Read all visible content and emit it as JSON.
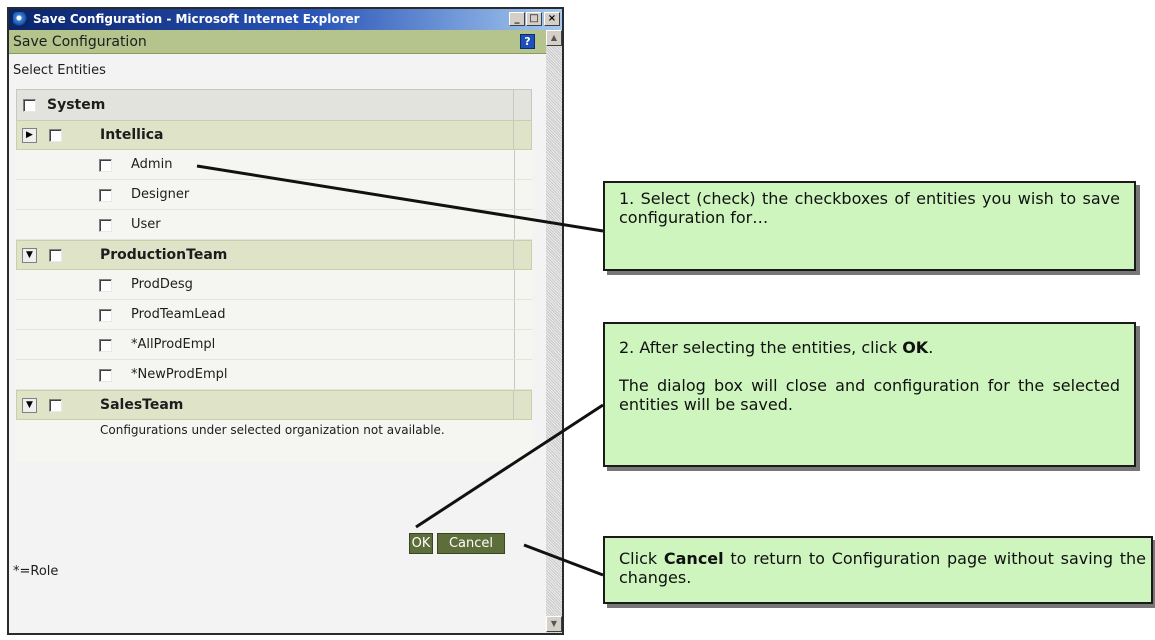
{
  "window": {
    "title": "Save Configuration - Microsoft Internet Explorer",
    "minimize": "_",
    "maximize": "□",
    "close": "×"
  },
  "dialog": {
    "header": "Save Configuration",
    "help": "?",
    "select_label": "Select Entities",
    "system_label": "System",
    "groups": [
      {
        "label": "Intellica",
        "expander": "collapsed",
        "items": [
          "Admin",
          "Designer",
          "User"
        ]
      },
      {
        "label": "ProductionTeam",
        "expander": "expanded",
        "items": [
          "ProdDesg",
          "ProdTeamLead",
          "*AllProdEmpl",
          "*NewProdEmpl"
        ]
      },
      {
        "label": "SalesTeam",
        "expander": "expanded",
        "note": "Configurations under selected organization not available."
      }
    ],
    "ok_label": "OK",
    "cancel_label": "Cancel",
    "role_note": "*=Role"
  },
  "callouts": {
    "c1": "1. Select (check) the checkboxes of entities you wish to save configuration for…",
    "c2_pre": "2. After selecting the entities, click ",
    "c2_bold": "OK",
    "c2_post": ".",
    "c2_para2": "The dialog box will close and configuration for the selected entities will be saved.",
    "c3_pre": "Click ",
    "c3_bold": "Cancel",
    "c3_post": " to return to Configuration page without saving the changes."
  },
  "colors": {
    "header_bg": "#b5c38d",
    "group_row_bg": "#dfe4c8",
    "button_bg": "#5e6e3a",
    "callout_bg": "#cdf5bd",
    "titlebar": "#0a246a"
  },
  "icons": {
    "app": "ie-icon",
    "help": "help-icon",
    "expand_collapsed": "triangle-right",
    "expand_expanded": "triangle-down"
  }
}
